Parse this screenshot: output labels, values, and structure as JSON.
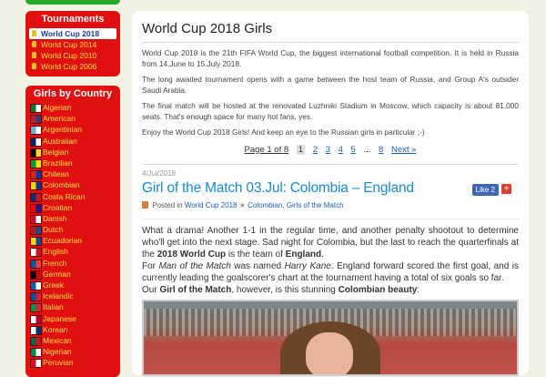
{
  "sidebar": {
    "tournaments": {
      "title": "Tournaments",
      "items": [
        "World Cup 2018",
        "World Cup 2014",
        "World Cup 2010",
        "World Cup 2006"
      ],
      "selected_index": 0
    },
    "girls_by_country": {
      "title": "Girls by Country",
      "countries": [
        {
          "label": "Algerian",
          "colors": [
            "#0a7a2a",
            "#ffffff"
          ]
        },
        {
          "label": "American",
          "colors": [
            "#b22234",
            "#3c3b6e"
          ]
        },
        {
          "label": "Argentinian",
          "colors": [
            "#74acdf",
            "#ffffff"
          ]
        },
        {
          "label": "Australian",
          "colors": [
            "#012169",
            "#ffffff"
          ]
        },
        {
          "label": "Belgian",
          "colors": [
            "#000000",
            "#fdda24"
          ]
        },
        {
          "label": "Brazilian",
          "colors": [
            "#009c3b",
            "#ffdf00"
          ]
        },
        {
          "label": "Chilean",
          "colors": [
            "#d52b1e",
            "#0039a6"
          ]
        },
        {
          "label": "Colombian",
          "colors": [
            "#fcd116",
            "#003893"
          ]
        },
        {
          "label": "Costa Rican",
          "colors": [
            "#002b7f",
            "#ce1126"
          ]
        },
        {
          "label": "Croatian",
          "colors": [
            "#ff0000",
            "#171796"
          ]
        },
        {
          "label": "Danish",
          "colors": [
            "#c8102e",
            "#ffffff"
          ]
        },
        {
          "label": "Dutch",
          "colors": [
            "#ae1c28",
            "#21468b"
          ]
        },
        {
          "label": "Ecuadorian",
          "colors": [
            "#ffdd00",
            "#034ea2"
          ]
        },
        {
          "label": "English",
          "colors": [
            "#ffffff",
            "#ce1124"
          ]
        },
        {
          "label": "French",
          "colors": [
            "#0055a4",
            "#ef4135"
          ]
        },
        {
          "label": "German",
          "colors": [
            "#000000",
            "#dd0000"
          ]
        },
        {
          "label": "Greek",
          "colors": [
            "#0d5eaf",
            "#ffffff"
          ]
        },
        {
          "label": "Icelandic",
          "colors": [
            "#02529c",
            "#dc1e35"
          ]
        },
        {
          "label": "Italian",
          "colors": [
            "#009246",
            "#ce2b37"
          ]
        },
        {
          "label": "Japanese",
          "colors": [
            "#ffffff",
            "#bc002d"
          ]
        },
        {
          "label": "Korean",
          "colors": [
            "#ffffff",
            "#003478"
          ]
        },
        {
          "label": "Mexican",
          "colors": [
            "#006847",
            "#ce1126"
          ]
        },
        {
          "label": "Nigerian",
          "colors": [
            "#008751",
            "#ffffff"
          ]
        },
        {
          "label": "Peruvian",
          "colors": [
            "#d91023",
            "#ffffff"
          ]
        }
      ]
    }
  },
  "main": {
    "page_title": "World Cup 2018 Girls",
    "intro": [
      "World Cup 2018 is the 21th FIFA World Cup, the biggest international football competition. It is held in Russia from 14.June to 15.July 2018.",
      "The long awaited tournament opens with a game between the host team of Russia, and Group A's outsider Saudi Arabia.",
      "The final match will be hosted at the renovated Luzhniki Stadium in Moscow, which capacity is about 81,000 seats. That's enough space for many hot fans, yes.",
      "Enjoy the World Cup 2018 Girls! And keep an eye to the Russian girls in particular ;-)"
    ],
    "pager": {
      "info": "Page 1 of 8",
      "current": "1",
      "pages": [
        "2",
        "3",
        "4",
        "5"
      ],
      "ellipsis": "...",
      "last": "8",
      "next": "Next »"
    },
    "post": {
      "date": "4/Jul/2018",
      "title": "Girl of the Match 03.Jul: Colombia – England",
      "like_label": "Like 2",
      "plus_label": "+",
      "meta_prefix": "Posted in",
      "meta_category": "World Cup 2018",
      "meta_tags": "Colombian, Girls of the Match",
      "body_1a": "What a drama! Another 1-1 in the regular time, and another penalty shootout to determine who'll get into the next stage. Sad night for Colombia, but the last to reach the quarterfinals at the ",
      "body_1b": "2018 World Cup",
      "body_1c": " is the team of ",
      "body_1d": "England",
      "body_1e": ".",
      "body_2a": "For ",
      "body_2b": "Man of the Match",
      "body_2c": " was named ",
      "body_2d": "Harry Kane",
      "body_2e": ". England forward scored the first goal, and is currently leading the goalscorer's chart at the tournament having a total of six goals so far.",
      "body_3a": "Our ",
      "body_3b": "Girl of the Match",
      "body_3c": ", however, is this stunning ",
      "body_3d": "Colombian beauty",
      "body_3e": ":"
    }
  }
}
